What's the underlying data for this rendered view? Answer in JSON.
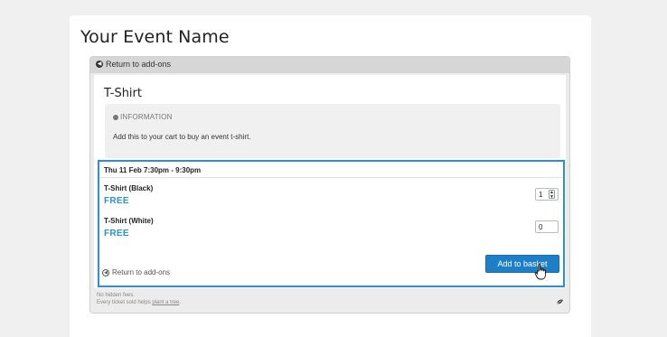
{
  "event": {
    "title": "Your Event Name"
  },
  "nav": {
    "back_label": "Return to add-ons"
  },
  "product": {
    "title": "T-Shirt",
    "info_label": "INFORMATION",
    "info_text": "Add this to your cart to buy an event t-shirt."
  },
  "session": {
    "date": "Thu 11 Feb 7:30pm - 9:30pm"
  },
  "tickets": [
    {
      "name": "T-Shirt (Black)",
      "price": "FREE",
      "qty": "1"
    },
    {
      "name": "T-Shirt (White)",
      "price": "FREE",
      "qty": "0"
    }
  ],
  "actions": {
    "add_to_basket": "Add to basket",
    "back_label": "Return to add-ons"
  },
  "footer": {
    "line1": "No hidden fees.",
    "line2_prefix": "Every ticket sold helps ",
    "line2_link": "plant a tree",
    "line2_suffix": "."
  },
  "colors": {
    "accent": "#2d8fd6",
    "button": "#1f7fc6"
  }
}
